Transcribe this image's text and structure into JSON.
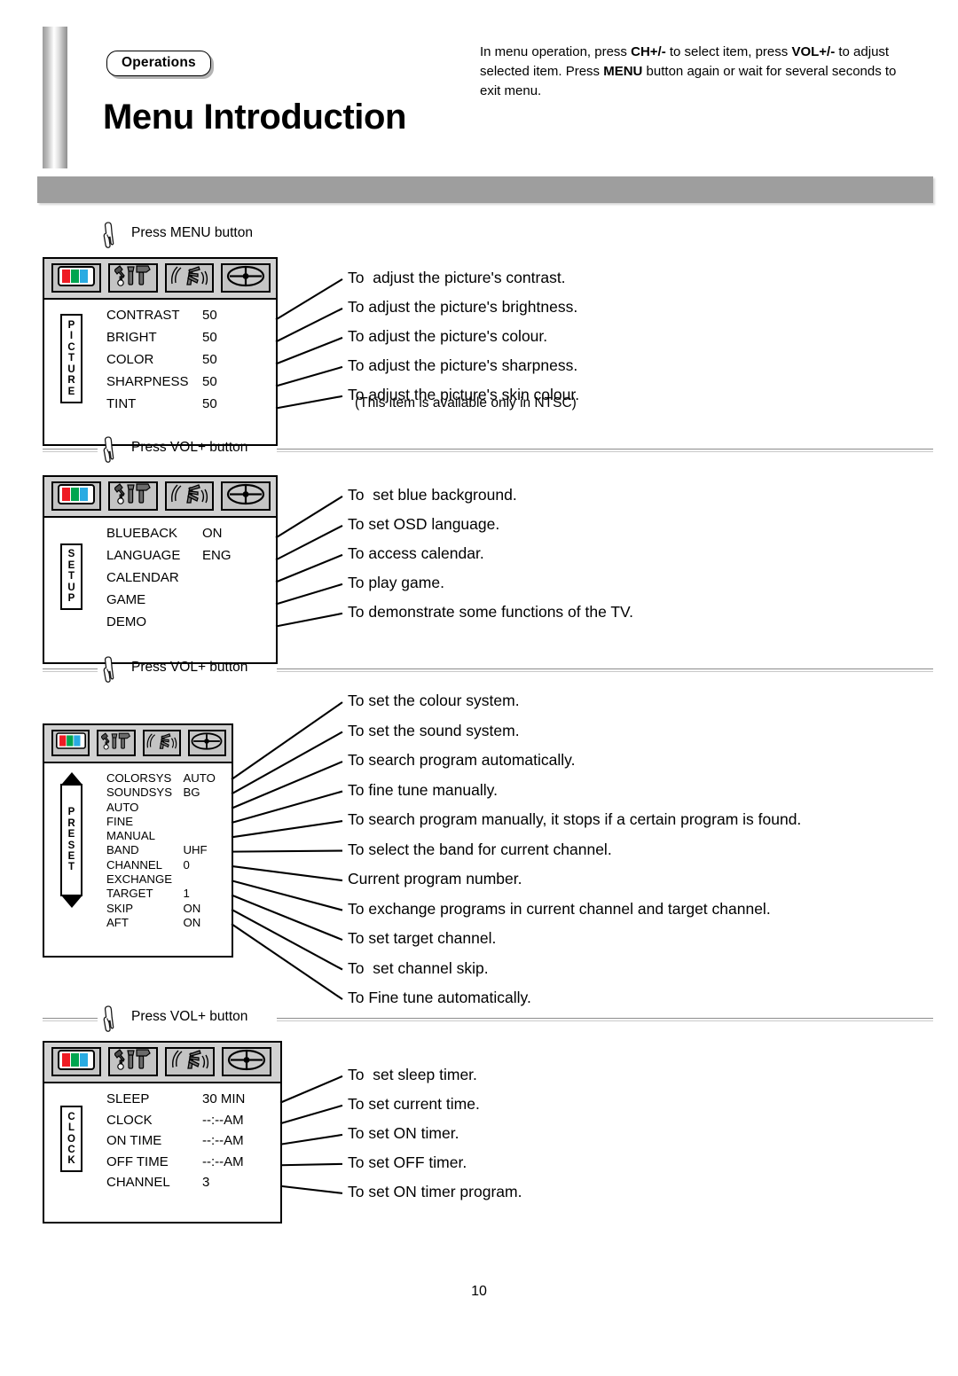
{
  "header": {
    "section_badge": "Operations",
    "title": "Menu Introduction",
    "intro_line1_a": "In menu operation, press ",
    "intro_line1_b": "CH+/-",
    "intro_line1_c": " to select item, press",
    "intro_line2_a": "VOL+/-",
    "intro_line2_b": " to adjust selected item. Press ",
    "intro_line2_c": "MENU",
    "intro_line2_d": " button",
    "intro_line3": "again or wait for several seconds to exit menu."
  },
  "icons": {
    "picture": "color-bars-icon",
    "setup": "tools-icon",
    "preset": "antenna-signal-icon",
    "clock": "clock-crosshair-icon",
    "hand": "pointing-hand-icon"
  },
  "groups": [
    {
      "id": "picture",
      "press_label": "Press MENU button",
      "side_label": "PICTURE",
      "has_scroll_arrows": false,
      "rows": [
        {
          "key": "CONTRAST",
          "value": "50"
        },
        {
          "key": "BRIGHT",
          "value": "50"
        },
        {
          "key": "COLOR",
          "value": "50"
        },
        {
          "key": "SHARPNESS",
          "value": "50"
        },
        {
          "key": "TINT",
          "value": "50"
        }
      ],
      "descriptions": [
        "To  adjust the picture's contrast.",
        "To adjust the picture's brightness.",
        "To adjust the picture's colour.",
        "To adjust the picture's sharpness.",
        "To adjust the picture's skin colour."
      ],
      "description_note": "(This item is available only in NTSC)"
    },
    {
      "id": "setup",
      "press_label": "Press VOL+ button",
      "side_label": "SETUP",
      "has_scroll_arrows": false,
      "rows": [
        {
          "key": "BLUEBACK",
          "value": "ON"
        },
        {
          "key": "LANGUAGE",
          "value": "ENG"
        },
        {
          "key": "CALENDAR",
          "value": ""
        },
        {
          "key": "GAME",
          "value": ""
        },
        {
          "key": "DEMO",
          "value": ""
        }
      ],
      "descriptions": [
        "To  set blue background.",
        "To set OSD language.",
        "To access calendar.",
        "To play game.",
        "To demonstrate some functions of the TV."
      ],
      "description_note": ""
    },
    {
      "id": "preset",
      "press_label": "Press VOL+ button",
      "side_label": "PRESET",
      "has_scroll_arrows": true,
      "rows": [
        {
          "key": "COLORSYS",
          "value": "AUTO"
        },
        {
          "key": "SOUNDSYS",
          "value": "BG"
        },
        {
          "key": "AUTO",
          "value": ""
        },
        {
          "key": "FINE",
          "value": ""
        },
        {
          "key": "MANUAL",
          "value": ""
        },
        {
          "key": "BAND",
          "value": "UHF"
        },
        {
          "key": "CHANNEL",
          "value": "0"
        },
        {
          "key": "EXCHANGE",
          "value": ""
        },
        {
          "key": "TARGET",
          "value": "1"
        },
        {
          "key": "SKIP",
          "value": "ON"
        },
        {
          "key": "AFT",
          "value": "ON"
        }
      ],
      "descriptions": [
        "To set the colour system.",
        "To set the sound system.",
        "To search program automatically.",
        "To fine tune manually.",
        "To search program manually, it stops if a certain program is found.",
        "To select the band for current channel.",
        "Current program number.",
        "To exchange programs in current channel and target channel.",
        "To set target channel.",
        "To  set channel skip.",
        "To Fine tune automatically."
      ],
      "description_note": ""
    },
    {
      "id": "clock",
      "press_label": "Press VOL+ button",
      "side_label": "CLOCK",
      "has_scroll_arrows": false,
      "rows": [
        {
          "key": "SLEEP",
          "value": "30 MIN"
        },
        {
          "key": "CLOCK",
          "value": "--:--AM"
        },
        {
          "key": "ON TIME",
          "value": "--:--AM"
        },
        {
          "key": "OFF TIME",
          "value": "--:--AM"
        },
        {
          "key": "CHANNEL",
          "value": "3"
        }
      ],
      "descriptions": [
        "To  set sleep timer.",
        "To set current time.",
        "To set ON timer.",
        "To set OFF timer.",
        "To set ON timer program."
      ],
      "description_note": ""
    }
  ],
  "footer": {
    "page_number": "10"
  },
  "colors": {
    "bar_red": "#ee1c24",
    "bar_green": "#00a550",
    "bar_cyan": "#29abe2",
    "band_gray": "#9e9e9e",
    "icon_bg": "#c4c4c4",
    "iconrow_bg": "#d2d2d2"
  }
}
